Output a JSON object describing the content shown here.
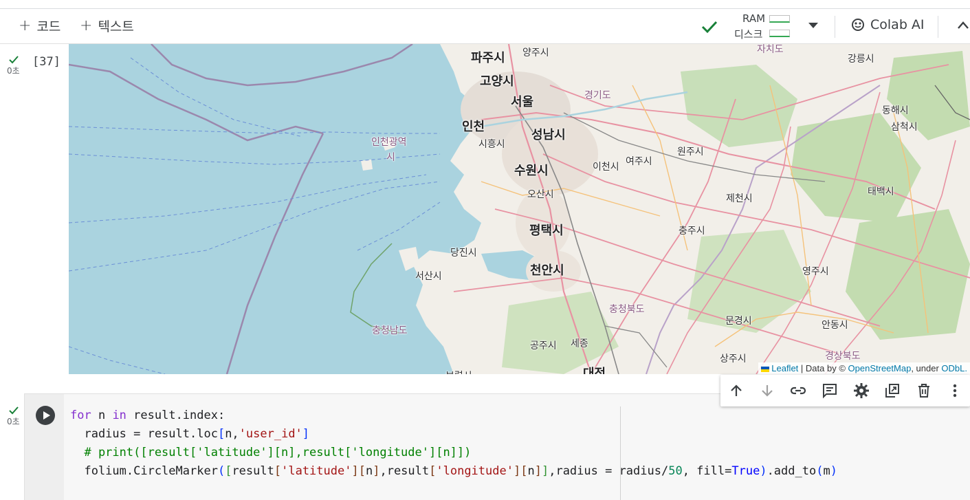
{
  "toolbar": {
    "add_code": "코드",
    "add_text": "텍스트",
    "ram_label": "RAM",
    "disk_label": "디스크",
    "colab_ai": "Colab AI"
  },
  "cell1": {
    "exec_count": "[37]",
    "time": "0초"
  },
  "map": {
    "cities": {
      "paju": "파주시",
      "yangju": "양주시",
      "goyang": "고양시",
      "seoul": "서울",
      "gyeonggi": "경기도",
      "incheon": "인천",
      "incheon_metro": "인천광역",
      "incheon_metro_2": "시",
      "siheung": "시흥시",
      "seongnam": "성남시",
      "suwon": "수원시",
      "icheon": "이천시",
      "yeoju": "여주시",
      "wonju": "원주시",
      "osan": "오산시",
      "pyeongtaek": "평택시",
      "dangjin": "당진시",
      "seosan": "서산시",
      "cheonan": "천안시",
      "chungbuk": "충청북도",
      "chungnam": "충청남도",
      "gongju": "공주시",
      "sejong": "세종",
      "daejeon": "대전",
      "chungju": "충주시",
      "jecheon": "제천시",
      "yeongju": "영주시",
      "mungyeong": "문경시",
      "andong": "안동시",
      "sangju": "상주시",
      "gyeongbuk": "경상북도",
      "gangneung": "강릉시",
      "donghae": "동해시",
      "samcheok": "삼척시",
      "taebaek": "태백시",
      "jachido": "자치도",
      "boryeong": "보령시"
    },
    "attribution": {
      "leaflet": "Leaflet",
      "data_by": "| Data by ©",
      "osm": "OpenStreetMap",
      "under": ", under",
      "odbl": "ODbL."
    }
  },
  "cell2": {
    "time": "0초",
    "code": [
      "for n in result.index:",
      "  radius = result.loc[n,'user_id']",
      "  # print([result['latitude'][n],result['longitude'][n]])",
      "  folium.CircleMarker([result['latitude'][n],result['longitude'][n]],radius = radius/50, fill=True).add_to(m)"
    ]
  },
  "colors": {
    "water": "#aad3df",
    "land": "#f2efe9",
    "forest": "#add19e",
    "check": "#188038"
  }
}
